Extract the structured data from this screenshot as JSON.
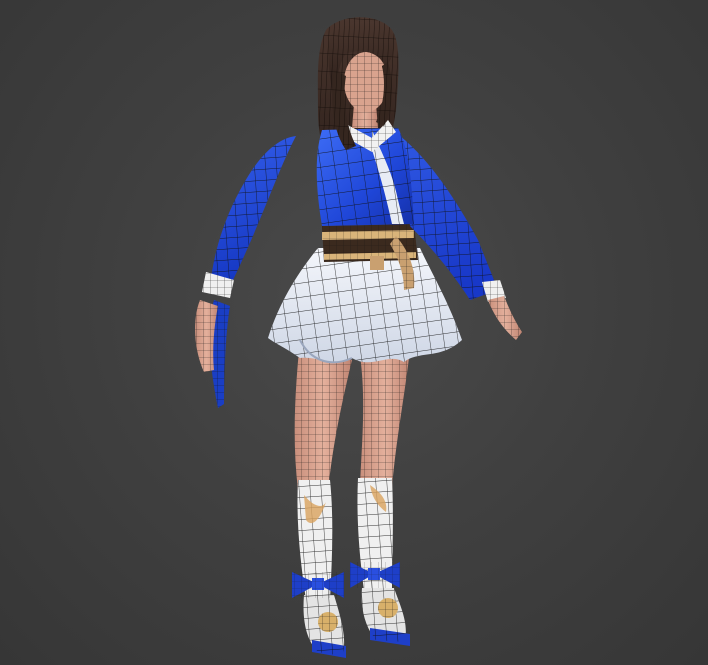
{
  "viewport": {
    "background_color": "#404040",
    "shading_mode": "smooth-shaded-with-wireframe-edges",
    "wireframe_color": "#111111"
  },
  "model": {
    "kind": "character-mesh",
    "palette": {
      "hair": "#3a2a24",
      "skin": "#d9a38e",
      "top": "#1f46d8",
      "top_light": "#3a67f0",
      "collar": "#f2f2f2",
      "skirt": "#e8ecf4",
      "sash": "#3b2a1e",
      "sash_trim": "#d9b47a",
      "sock": "#f0f0f0",
      "bow": "#1e3fc8",
      "shoe": "#d8b06a"
    }
  }
}
